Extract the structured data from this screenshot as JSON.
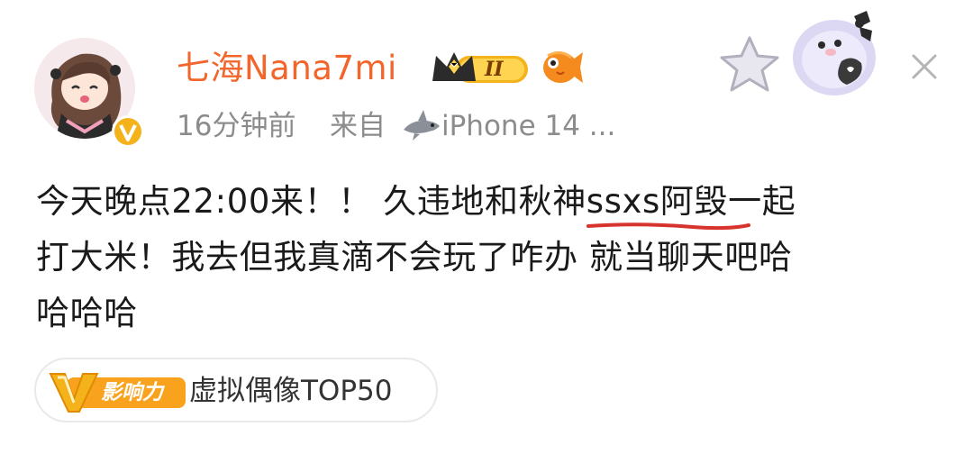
{
  "post": {
    "username": "七海Nana7mi",
    "member_level": "II",
    "time_ago": "16分钟前",
    "source_prefix": "来自",
    "device": "iPhone 14 ...",
    "text_line1_before": "今天晚点22:00来！！ 久违地和秋神",
    "text_line1_highlight": "ssxs阿毁",
    "text_line1_after": "一起",
    "text_line2": "打大米！我去但我真滴不会玩了咋办 就当聊天吧哈",
    "text_line3": "哈哈哈",
    "annotation_color": "#d8342e"
  },
  "tag": {
    "logo_label": "影响力",
    "label": "虚拟偶像TOP50"
  },
  "icons": {
    "avatar": "avatar-anime-girl",
    "verified": "gold-v-verified-icon",
    "crown": "crown-member-icon",
    "fish": "goldfish-icon",
    "shark": "shark-icon",
    "star": "star-sticker-icon",
    "penguin": "penguin-sticker-icon",
    "close": "close-icon"
  },
  "colors": {
    "username": "#f2652b",
    "meta": "#8c8c8c",
    "text": "#1a1a1a",
    "badge_gold": "#f4b21b"
  }
}
